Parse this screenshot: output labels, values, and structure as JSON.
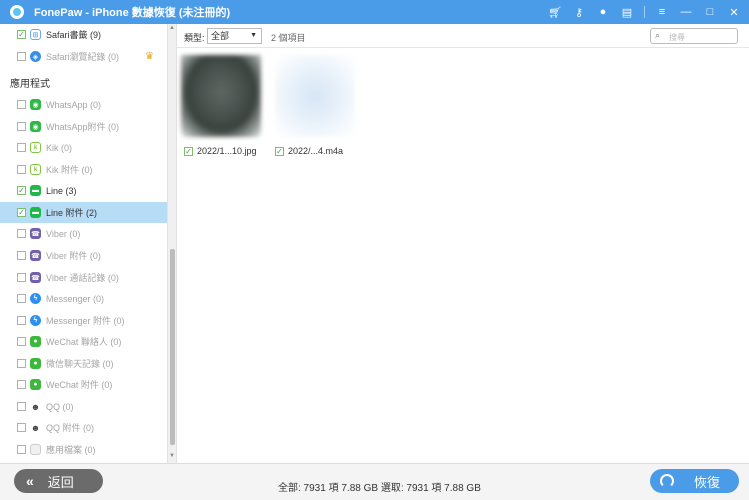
{
  "titlebar": {
    "title": "FonePaw - iPhone 數據恢復 (未注冊的)"
  },
  "sidebar": {
    "items": [
      {
        "label": "Safari書籤 (9)",
        "checked": true,
        "dim": false,
        "icon": "bookmark-icon",
        "color": "#6ea8e8"
      },
      {
        "label": "Safari瀏覽紀錄 (0)",
        "checked": false,
        "dim": true,
        "icon": "safari-icon",
        "color": "#3b8ee6",
        "crown": true
      },
      {
        "label": "WhatsApp (0)",
        "checked": false,
        "dim": true,
        "icon": "whatsapp-icon",
        "color": "#2fb843"
      },
      {
        "label": "WhatsApp附件 (0)",
        "checked": false,
        "dim": true,
        "icon": "whatsapp-icon",
        "color": "#2fb843"
      },
      {
        "label": "Kik (0)",
        "checked": false,
        "dim": true,
        "icon": "kik-icon",
        "color": "#82c341"
      },
      {
        "label": "Kik 附件 (0)",
        "checked": false,
        "dim": true,
        "icon": "kik-icon",
        "color": "#82c341"
      },
      {
        "label": "Line (3)",
        "checked": true,
        "dim": false,
        "icon": "line-icon",
        "color": "#1fb94a"
      },
      {
        "label": "Line 附件 (2)",
        "checked": true,
        "dim": false,
        "icon": "line-icon",
        "color": "#1fb94a",
        "selected": true
      },
      {
        "label": "Viber (0)",
        "checked": false,
        "dim": true,
        "icon": "viber-icon",
        "color": "#7360a8"
      },
      {
        "label": "Viber 附件 (0)",
        "checked": false,
        "dim": true,
        "icon": "viber-icon",
        "color": "#7360a8"
      },
      {
        "label": "Viber 通話記錄 (0)",
        "checked": false,
        "dim": true,
        "icon": "viber-icon",
        "color": "#7360a8"
      },
      {
        "label": "Messenger (0)",
        "checked": false,
        "dim": true,
        "icon": "messenger-icon",
        "color": "#2d8ff0"
      },
      {
        "label": "Messenger 附件 (0)",
        "checked": false,
        "dim": true,
        "icon": "messenger-icon",
        "color": "#2d8ff0"
      },
      {
        "label": "WeChat 聯絡人 (0)",
        "checked": false,
        "dim": true,
        "icon": "wechat-icon",
        "color": "#3cb93c"
      },
      {
        "label": "微信聊天記錄 (0)",
        "checked": false,
        "dim": true,
        "icon": "wechat-icon",
        "color": "#3cb93c"
      },
      {
        "label": "WeChat 附件 (0)",
        "checked": false,
        "dim": true,
        "icon": "wechat-icon",
        "color": "#3cb93c"
      },
      {
        "label": "QQ (0)",
        "checked": false,
        "dim": true,
        "icon": "qq-icon",
        "color": "#444444"
      },
      {
        "label": "QQ 附件 (0)",
        "checked": false,
        "dim": true,
        "icon": "qq-icon",
        "color": "#444444"
      },
      {
        "label": "應用檔案 (0)",
        "checked": false,
        "dim": true,
        "icon": "app-file-icon",
        "color": "#cccccc"
      }
    ],
    "section_label": "應用程式"
  },
  "toolbar": {
    "type_label": "類型:",
    "type_value": "全部",
    "count": "2 個項目",
    "search_placeholder": "搜尋"
  },
  "files": [
    {
      "name": "2022/1...10.jpg",
      "checked": true
    },
    {
      "name": "2022/...4.m4a",
      "checked": true
    }
  ],
  "footer": {
    "back_label": "返回",
    "summary": "全部: 7931 項 7.88 GB 選取: 7931 項 7.88 GB",
    "recover_label": "恢復"
  },
  "colors": {
    "accent": "#4a9be8",
    "selected_row": "#b7dcf6"
  }
}
